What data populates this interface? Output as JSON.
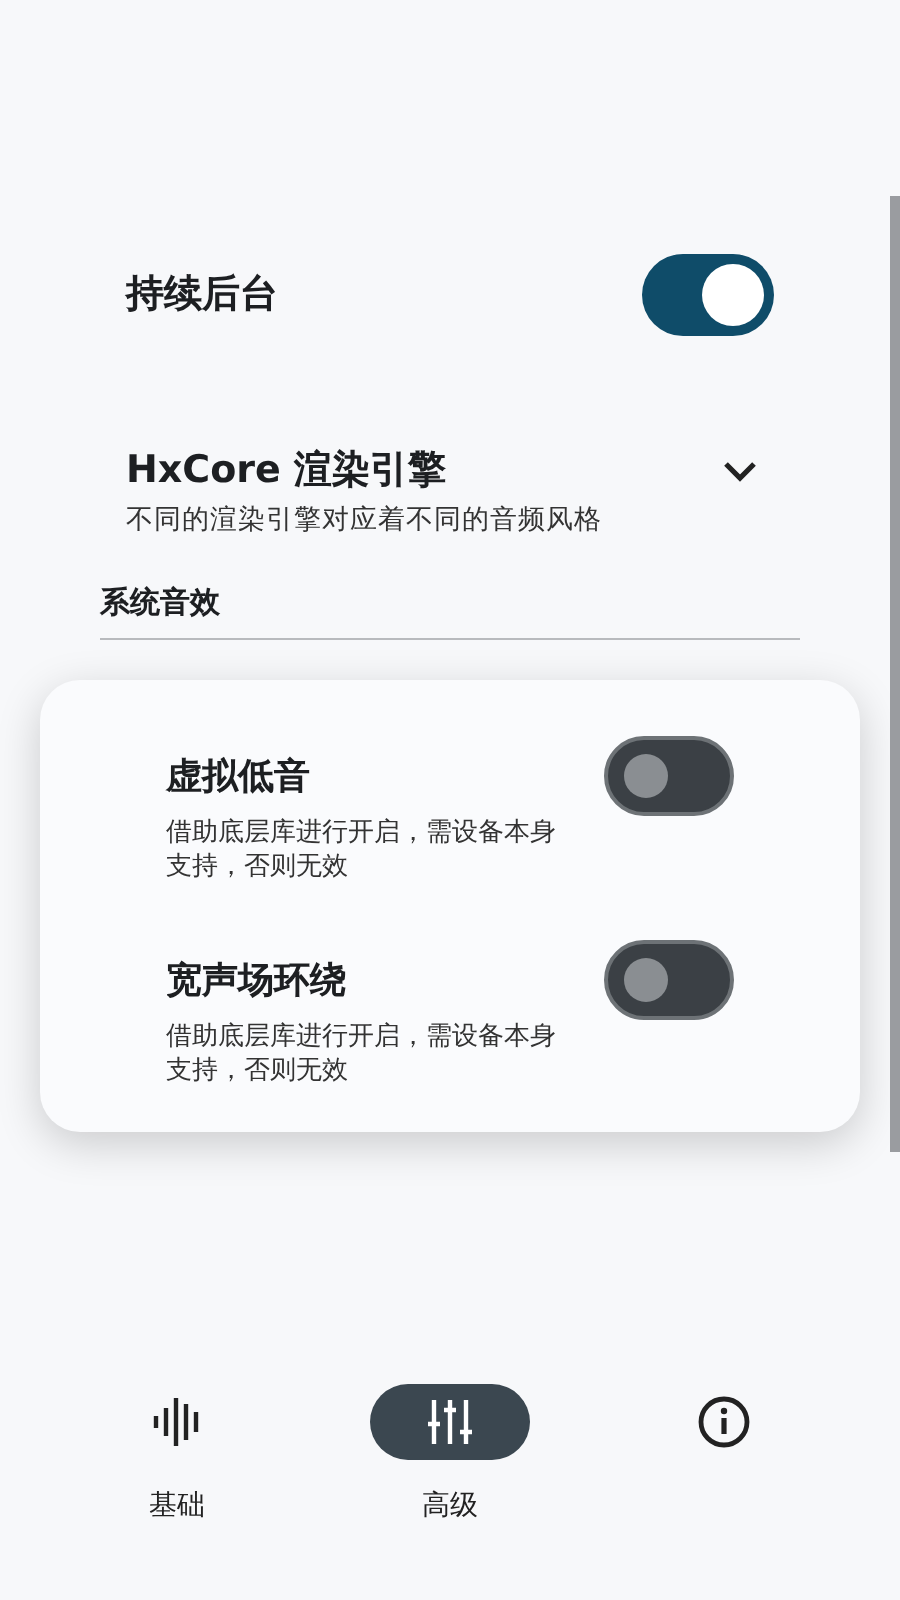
{
  "settings": [
    {
      "kind": "toggle",
      "title": "持续后台",
      "on": true
    },
    {
      "kind": "dropdown",
      "title": "HxCore 渲染引擎",
      "description": "不同的渲染引擎对应着不同的音频风格"
    }
  ],
  "section": {
    "title": "系统音效",
    "items": [
      {
        "title": "虚拟低音",
        "description": "借助底层库进行开启，需设备本身支持，否则无效",
        "on": false
      },
      {
        "title": "宽声场环绕",
        "description": "借助底层库进行开启，需设备本身支持，否则无效",
        "on": false
      }
    ]
  },
  "nav": [
    {
      "kind": "wave",
      "label": "基础",
      "selected": false
    },
    {
      "kind": "sliders",
      "label": "高级",
      "selected": true
    },
    {
      "kind": "info",
      "selected": false
    }
  ]
}
